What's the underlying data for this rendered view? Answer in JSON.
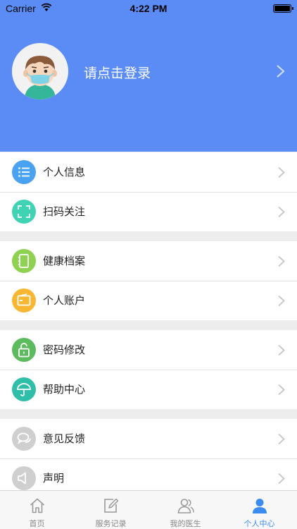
{
  "status_bar": {
    "carrier": "Carrier",
    "time": "4:22 PM"
  },
  "profile": {
    "login_prompt": "请点击登录"
  },
  "menu_groups": [
    {
      "items": [
        {
          "label": "个人信息",
          "icon": "list-icon",
          "color": "#4aa3f2"
        },
        {
          "label": "扫码关注",
          "icon": "scan-icon",
          "color": "#3fd3b4"
        }
      ]
    },
    {
      "items": [
        {
          "label": "健康档案",
          "icon": "notebook-icon",
          "color": "#8fd150"
        },
        {
          "label": "个人账户",
          "icon": "wallet-icon",
          "color": "#f7b733"
        }
      ]
    },
    {
      "items": [
        {
          "label": "密码修改",
          "icon": "lock-icon",
          "color": "#5cbb5c"
        },
        {
          "label": "帮助中心",
          "icon": "umbrella-icon",
          "color": "#2fbea8"
        }
      ]
    },
    {
      "items": [
        {
          "label": "意见反馈",
          "icon": "chat-icon",
          "color": "#cfcfcf"
        },
        {
          "label": "声明",
          "icon": "speaker-icon",
          "color": "#cfcfcf"
        }
      ]
    }
  ],
  "tab_bar": {
    "tabs": [
      {
        "label": "首页",
        "icon": "home-icon"
      },
      {
        "label": "服务记录",
        "icon": "edit-icon"
      },
      {
        "label": "我的医生",
        "icon": "doctors-icon"
      },
      {
        "label": "个人中心",
        "icon": "user-icon",
        "active": true
      }
    ]
  },
  "colors": {
    "header": "#5b8cf6",
    "tab_active": "#3b8bf0"
  }
}
